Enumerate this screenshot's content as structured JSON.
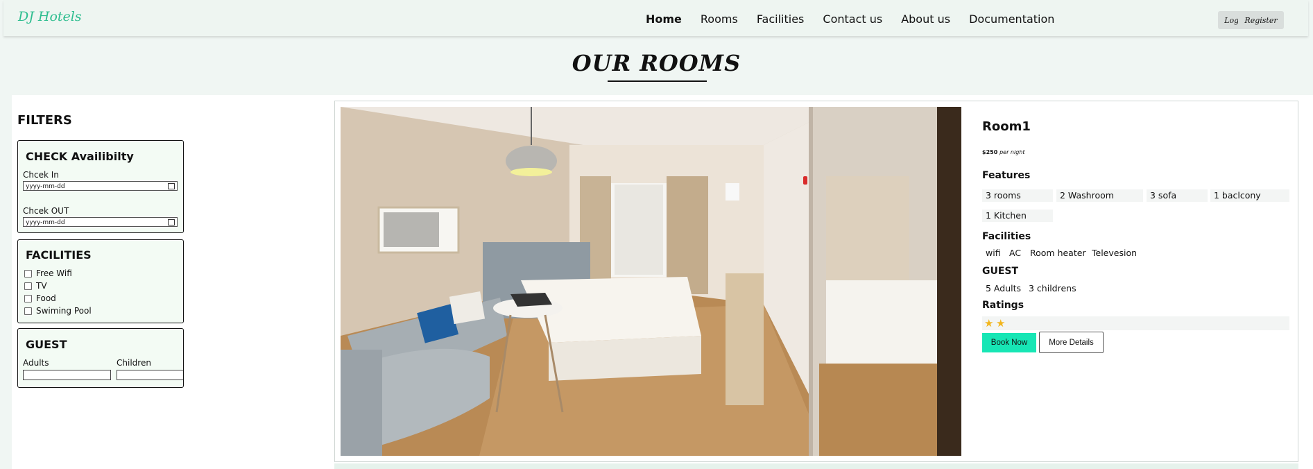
{
  "brand": "DJ Hotels",
  "nav": [
    "Home",
    "Rooms",
    "Facilities",
    "Contact us",
    "About us",
    "Documentation"
  ],
  "auth": {
    "login": "Login",
    "register": "Register"
  },
  "page_title": "OUR ROOMS",
  "filters": {
    "heading": "FILTERS",
    "check": {
      "title": "CHECK Availibilty",
      "checkin_label": "Chcek In",
      "checkout_label": "Chcek OUT",
      "date_placeholder": "yyyy-mm-dd"
    },
    "facilities": {
      "title": "FACILITIES",
      "options": [
        "Free Wifi",
        "TV",
        "Food",
        "Swiming Pool"
      ]
    },
    "guest": {
      "title": "GUEST",
      "adults_label": "Adults",
      "children_label": "Children"
    }
  },
  "room": {
    "name": "Room1",
    "price": "$250",
    "price_suffix": "per night",
    "features_title": "Features",
    "features": [
      "3 rooms",
      "2 Washroom",
      "3 sofa",
      "1 baclcony",
      "1 Kitchen"
    ],
    "facilities_title": "Facilities",
    "facilities": [
      "wifi",
      "AC",
      "Room heater",
      "Televesion"
    ],
    "guest_title": "GUEST",
    "guests": [
      "5 Adults",
      "3 childrens"
    ],
    "ratings_title": "Ratings",
    "rating": 2,
    "book_label": "Book Now",
    "details_label": "More Details"
  },
  "colors": {
    "brand": "#2ebd8f",
    "book_button": "#17e6b5",
    "star": "#f2b51c"
  }
}
